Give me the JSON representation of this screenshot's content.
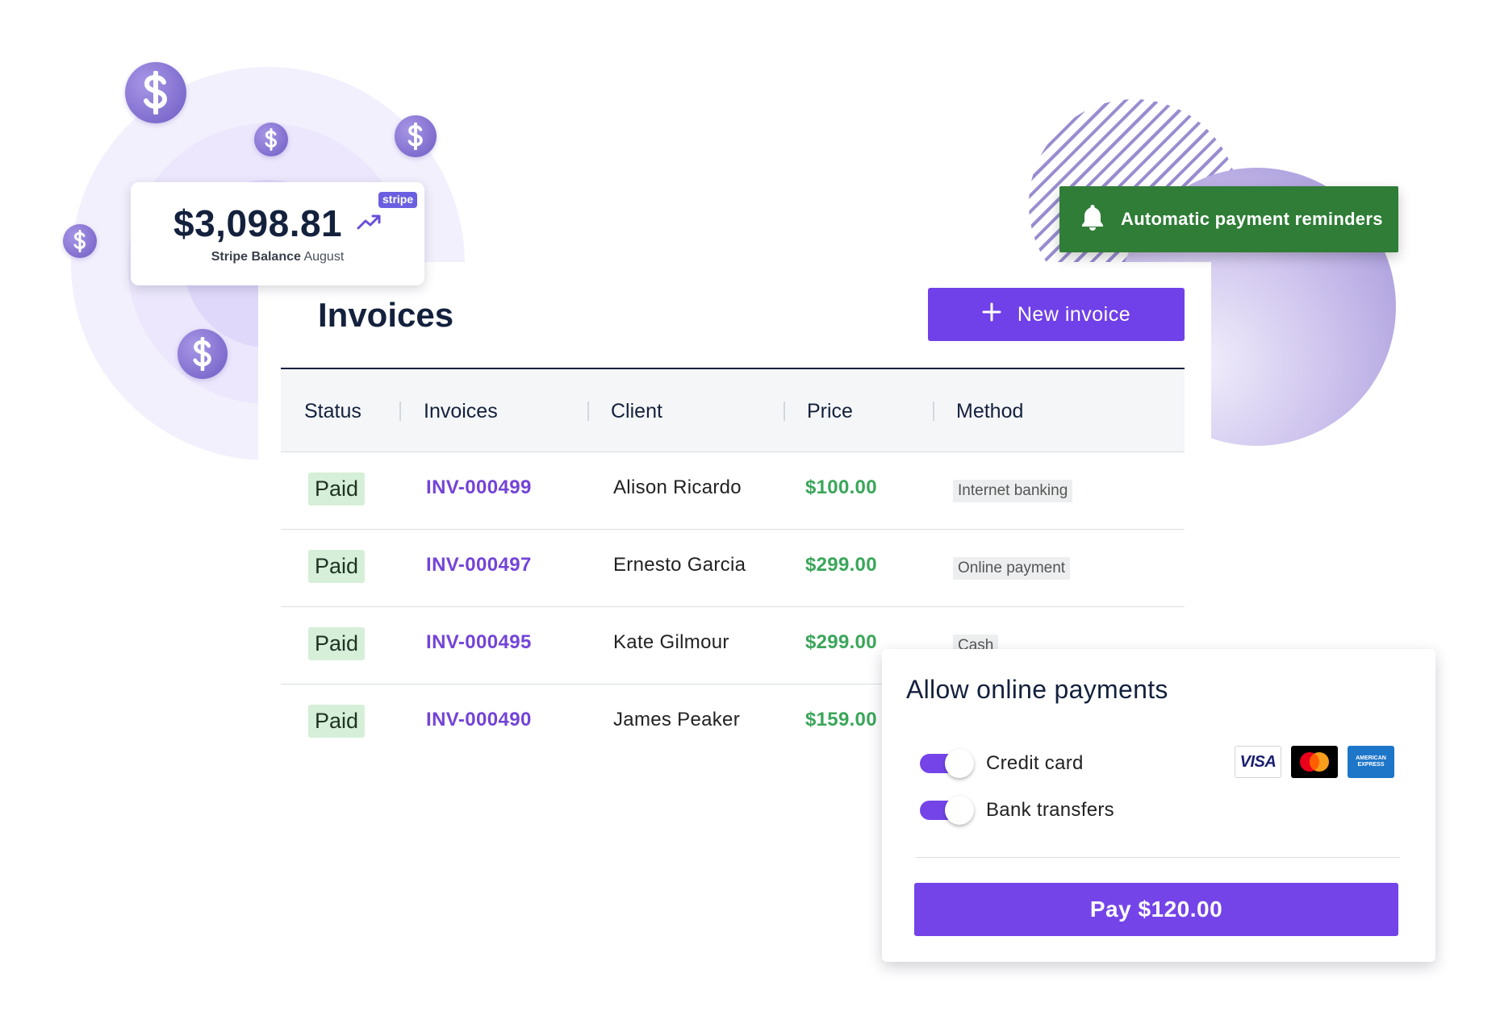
{
  "balance": {
    "amount": "$3,098.81",
    "label_strong": "Stripe Balance",
    "label_period": "August",
    "badge": "stripe",
    "trend_icon": "trending-up-icon"
  },
  "invoices": {
    "title": "Invoices",
    "new_button": {
      "label": "New invoice",
      "icon": "plus-icon"
    },
    "columns": [
      "Status",
      "Invoices",
      "Client",
      "Price",
      "Method"
    ],
    "rows": [
      {
        "status": "Paid",
        "id": "INV-000499",
        "client": "Alison Ricardo",
        "price": "$100.00",
        "method": "Internet banking"
      },
      {
        "status": "Paid",
        "id": "INV-000497",
        "client": "Ernesto Garcia",
        "price": "$299.00",
        "method": "Online payment"
      },
      {
        "status": "Paid",
        "id": "INV-000495",
        "client": "Kate Gilmour",
        "price": "$299.00",
        "method": "Cash"
      },
      {
        "status": "Paid",
        "id": "INV-000490",
        "client": "James Peaker",
        "price": "$159.00",
        "method": ""
      }
    ]
  },
  "reminder": {
    "label": "Automatic payment reminders",
    "icon": "bell-icon"
  },
  "payments": {
    "title": "Allow online payments",
    "options": [
      {
        "label": "Credit card",
        "enabled": true
      },
      {
        "label": "Bank transfers",
        "enabled": true
      }
    ],
    "card_brands": [
      "VISA",
      "mastercard",
      "AMERICAN EXPRESS"
    ],
    "pay_button": "Pay $120.00"
  },
  "colors": {
    "accent": "#7444e8",
    "paid_bg": "#d6efd8",
    "price": "#3aa65a",
    "reminder_bg": "#2f7d37"
  }
}
